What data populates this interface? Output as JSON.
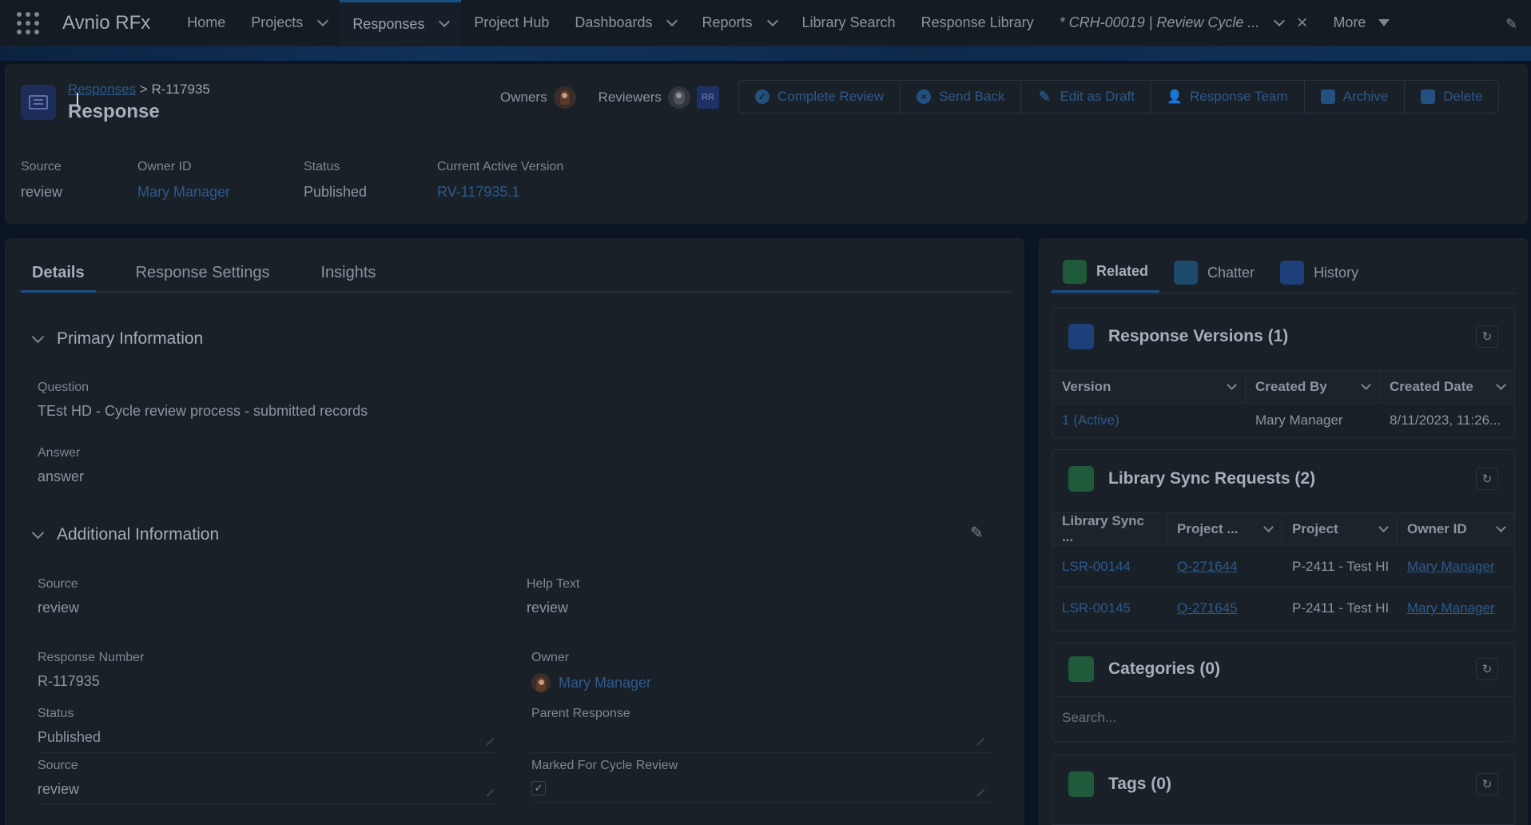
{
  "nav": {
    "app_name": "Avnio RFx",
    "items": [
      {
        "label": "Home",
        "dropdown": false
      },
      {
        "label": "Projects",
        "dropdown": true
      },
      {
        "label": "Responses",
        "dropdown": true,
        "active": true
      },
      {
        "label": "Project Hub",
        "dropdown": false
      },
      {
        "label": "Dashboards",
        "dropdown": true
      },
      {
        "label": "Reports",
        "dropdown": true
      },
      {
        "label": "Library Search",
        "dropdown": false
      },
      {
        "label": "Response Library",
        "dropdown": false
      }
    ],
    "open_tab": "* CRH-00019 | Review Cycle ...",
    "more_label": "More"
  },
  "header": {
    "breadcrumb_link": "Responses",
    "breadcrumb_sep": ">",
    "breadcrumb_current": "R-117935",
    "title": "Response",
    "owners_label": "Owners",
    "reviewers_label": "Reviewers",
    "reviewer_initials": "RR",
    "actions": [
      "Complete Review",
      "Send Back",
      "Edit as Draft",
      "Response Team",
      "Archive",
      "Delete"
    ],
    "fields": [
      {
        "label": "Source",
        "value": "review",
        "link": false
      },
      {
        "label": "Owner ID",
        "value": "Mary Manager",
        "link": true
      },
      {
        "label": "Status",
        "value": "Published",
        "link": false
      },
      {
        "label": "Current Active Version",
        "value": "RV-117935.1",
        "link": true
      }
    ]
  },
  "details": {
    "tabs": [
      "Details",
      "Response Settings",
      "Insights"
    ],
    "primary_section": "Primary Information",
    "question_label": "Question",
    "question_value": "TEst HD - Cycle review process - submitted records",
    "answer_label": "Answer",
    "answer_value": "answer",
    "additional_section": "Additional Information",
    "source_label": "Source",
    "source_value": "review",
    "help_label": "Help Text",
    "help_value": "review",
    "response_number_label": "Response Number",
    "response_number_value": "R-117935",
    "owner_label": "Owner",
    "owner_value": "Mary Manager",
    "status_label": "Status",
    "status_value": "Published",
    "parent_label": "Parent Response",
    "parent_value": "",
    "source2_label": "Source",
    "source2_value": "review",
    "cycle_label": "Marked For Cycle Review",
    "cycle_checked": "✓"
  },
  "related": {
    "tabs": [
      "Related",
      "Chatter",
      "History"
    ],
    "versions": {
      "title": "Response Versions (1)",
      "columns": [
        "Version",
        "Created By",
        "Created Date"
      ],
      "rows": [
        [
          "1 (Active)",
          "Mary Manager",
          "8/11/2023, 11:26..."
        ]
      ]
    },
    "sync": {
      "title": "Library Sync Requests (2)",
      "columns": [
        "Library Sync ...",
        "Project ...",
        "Project",
        "Owner ID"
      ],
      "rows": [
        [
          "LSR-00144",
          "Q-271644",
          "P-2411 - Test HI",
          "Mary Manager"
        ],
        [
          "LSR-00145",
          "Q-271645",
          "P-2411 - Test HI",
          "Mary Manager"
        ]
      ]
    },
    "categories": {
      "title": "Categories (0)",
      "search_placeholder": "Search..."
    },
    "tags": {
      "title": "Tags (0)"
    }
  },
  "colors": {
    "link": "#2d5a8c",
    "accent": "#1a4f86",
    "green_icon": "#1f5a3a",
    "blue_icon": "#1d3f7a"
  }
}
